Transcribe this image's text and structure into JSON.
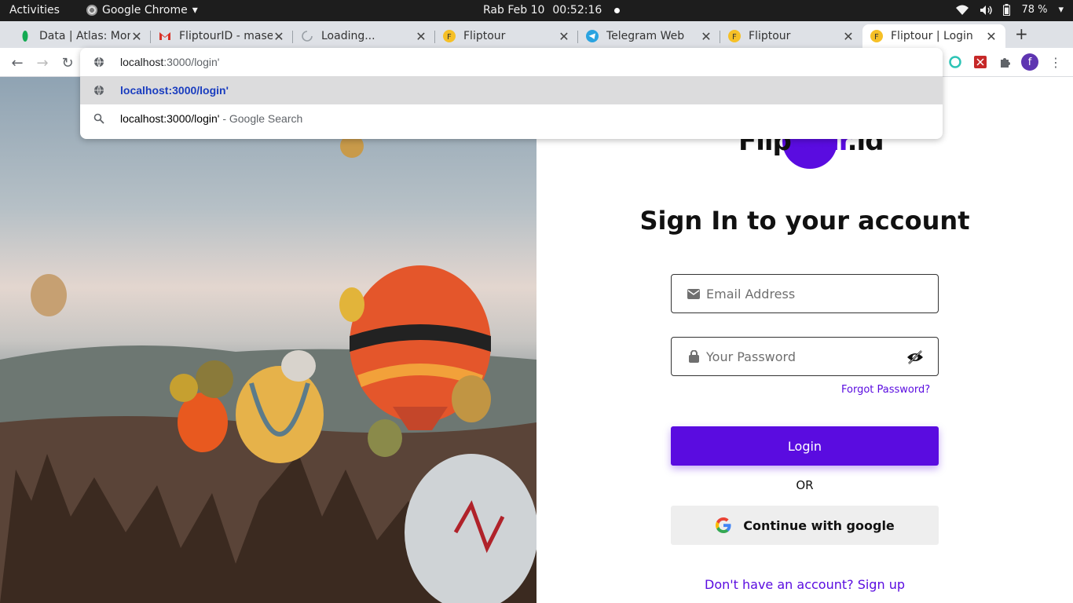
{
  "system": {
    "activities": "Activities",
    "app_name": "Google Chrome",
    "clock_day": "Rab Feb 10",
    "clock_time": "00:52:16",
    "battery": "78 %"
  },
  "tabs": [
    {
      "title": "Data | Atlas: Mon",
      "favicon": "mongodb-leaf-icon",
      "color": "#13aa52"
    },
    {
      "title": "FliptourID - mase",
      "favicon": "gmail-icon",
      "color": "#d93025"
    },
    {
      "title": "Loading...",
      "favicon": "loading-spinner-icon",
      "color": "#9aa0a6"
    },
    {
      "title": "Fliptour",
      "favicon": "fliptour-icon",
      "color": "#f6c026"
    },
    {
      "title": "Telegram Web",
      "favicon": "telegram-icon",
      "color": "#2aa3e0"
    },
    {
      "title": "Fliptour",
      "favicon": "fliptour-icon",
      "color": "#f6c026"
    },
    {
      "title": "Fliptour | Login",
      "favicon": "fliptour-icon",
      "color": "#f6c026"
    }
  ],
  "omnibox": {
    "input_host": "localhost",
    "input_path": ":3000/login'",
    "suggestion_url": "localhost:3000/login'",
    "search_query": "localhost:3000/login'",
    "search_suffix": " - Google Search"
  },
  "profile_initial": "f",
  "login": {
    "logo_left": "Flip",
    "logo_mid": "tour",
    "logo_right": ".id",
    "heading": "Sign In to your account",
    "email_placeholder": "Email Address",
    "password_placeholder": "Your Password",
    "forgot": "Forgot Password?",
    "login_button": "Login",
    "or": "OR",
    "google_button": "Continue with google",
    "signup": "Don't have an account? Sign up"
  },
  "colors": {
    "brand": "#5a0ce0",
    "topbar": "#1d1d1d",
    "tabstrip": "#dee1e6"
  }
}
